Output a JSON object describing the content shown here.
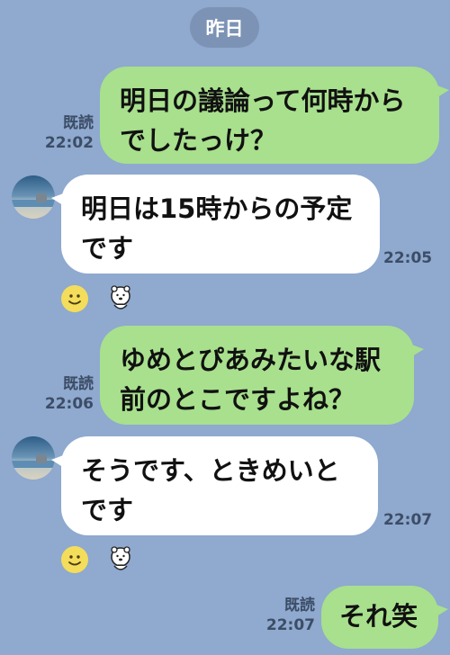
{
  "date_label": "昨日",
  "messages": [
    {
      "lines": [
        "明日の議論って何時から",
        "でしたっけ？"
      ],
      "read": "既読",
      "time": "22:02"
    },
    {
      "lines": [
        "明日は15時からの予定",
        "です"
      ],
      "time": "22:05"
    },
    {
      "lines": [
        "ゆめとぴあみたいな駅",
        "前のとこですよね？"
      ],
      "read": "既読",
      "time": "22:06"
    },
    {
      "lines": [
        "そうです、ときめいと",
        "です"
      ],
      "time": "22:07"
    },
    {
      "lines": [
        "それ笑"
      ],
      "read": "既読",
      "time": "22:07"
    }
  ],
  "icons": {
    "avatar": "beach-photo-avatar",
    "reaction_1": "smile-icon",
    "reaction_2": "bear-sticker-icon"
  },
  "colors": {
    "background": "#8fa9cf",
    "sent_bubble": "#a8e08d",
    "received_bubble": "#ffffff",
    "date_pill": "#7c93b5",
    "meta_text": "#3c4d66"
  }
}
